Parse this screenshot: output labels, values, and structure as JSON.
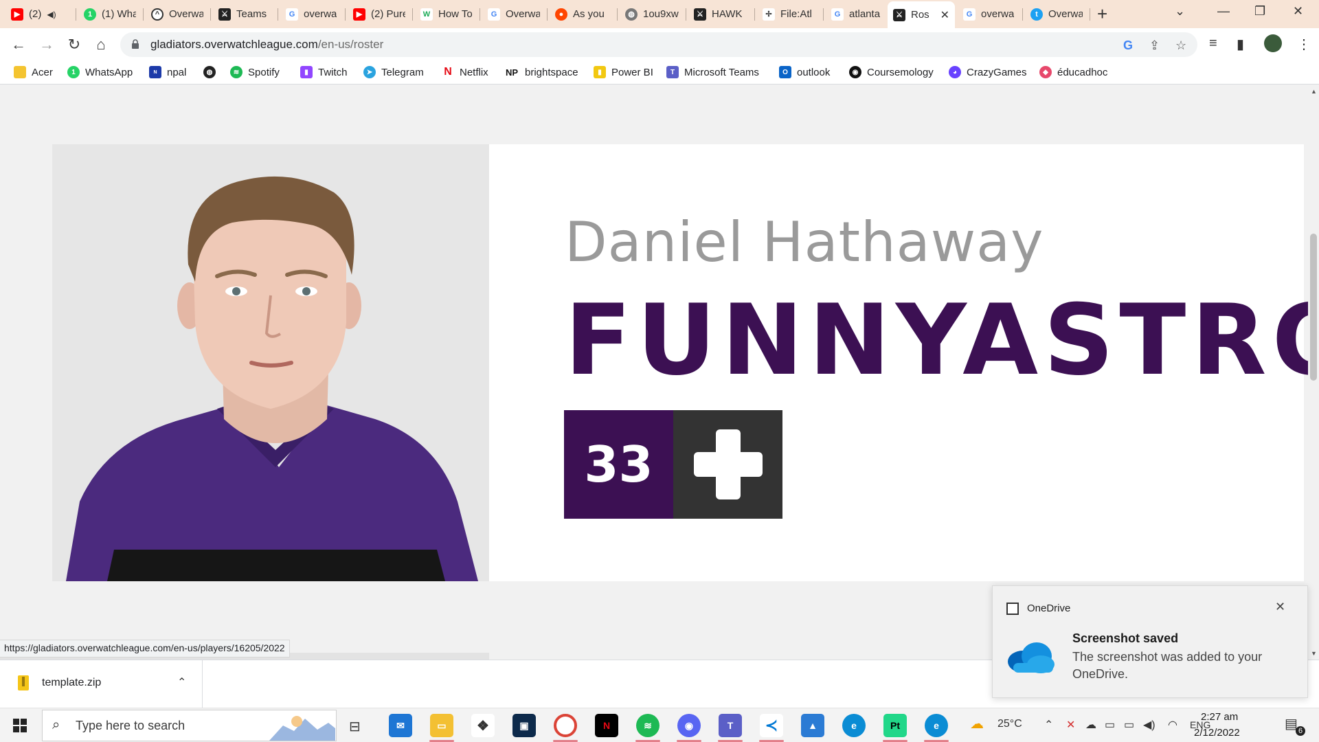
{
  "colors": {
    "brand_purple": "#3c1053",
    "role_box": "#333333",
    "name_grey": "#9a9a9a",
    "tabstrip": "#f7e4d6"
  },
  "tabs": [
    {
      "label": "(2)",
      "icon": "youtube-icon"
    },
    {
      "label": "(1) Wha",
      "icon": "whatsapp-icon"
    },
    {
      "label": "Overwa",
      "icon": "overwatch-icon"
    },
    {
      "label": "Teams",
      "icon": "gladiators-icon"
    },
    {
      "label": "overwa",
      "icon": "google-icon"
    },
    {
      "label": "(2) Pure",
      "icon": "youtube-icon"
    },
    {
      "label": "How To",
      "icon": "wikihow-icon"
    },
    {
      "label": "Overwa",
      "icon": "google-icon"
    },
    {
      "label": "As you",
      "icon": "reddit-icon"
    },
    {
      "label": "1ou9xw",
      "icon": "globe-icon"
    },
    {
      "label": "HAWK",
      "icon": "gladiators-icon"
    },
    {
      "label": "File:Atl",
      "icon": "wiki-icon"
    },
    {
      "label": "atlanta",
      "icon": "google-icon"
    },
    {
      "label": "Ros",
      "icon": "gladiators-icon",
      "active": true
    },
    {
      "label": "overwa",
      "icon": "google-icon"
    },
    {
      "label": "Overwa",
      "icon": "twitter-icon"
    }
  ],
  "address": {
    "host": "gladiators.overwatchleague.com",
    "path": "/en-us/roster"
  },
  "bookmarks": [
    {
      "label": "Acer",
      "icon": "folder-icon"
    },
    {
      "label": "WhatsApp",
      "icon": "whatsapp-icon"
    },
    {
      "label": "npal",
      "icon": "npal-icon"
    },
    {
      "label": "",
      "icon": "globe-icon"
    },
    {
      "label": "Spotify",
      "icon": "spotify-icon"
    },
    {
      "label": "Twitch",
      "icon": "twitch-icon"
    },
    {
      "label": "Telegram",
      "icon": "telegram-icon"
    },
    {
      "label": "Netflix",
      "icon": "netflix-icon"
    },
    {
      "label": "brightspace",
      "icon": "brightspace-icon"
    },
    {
      "label": "Power BI",
      "icon": "powerbi-icon"
    },
    {
      "label": "Microsoft Teams",
      "icon": "teams-icon"
    },
    {
      "label": "outlook",
      "icon": "outlook-icon"
    },
    {
      "label": "Coursemology",
      "icon": "coursemology-icon"
    },
    {
      "label": "CrazyGames",
      "icon": "crazygames-icon"
    },
    {
      "label": "éducadhoc",
      "icon": "educadhoc-icon"
    }
  ],
  "player": {
    "real_name": "Daniel Hathaway",
    "handle": "FUNNYASTRO",
    "number": "33",
    "role_icon": "support-plus-icon"
  },
  "status_url": "https://gladiators.overwatchleague.com/en-us/players/16205/2022",
  "download": {
    "filename": "template.zip"
  },
  "toast": {
    "app": "OneDrive",
    "title": "Screenshot saved",
    "body": "The screenshot was added to your OneDrive."
  },
  "taskbar": {
    "search_placeholder": "Type here to search",
    "weather": "25°C",
    "language": "ENG",
    "time": "2:27 am",
    "date": "2/12/2022",
    "notifications": "6"
  }
}
